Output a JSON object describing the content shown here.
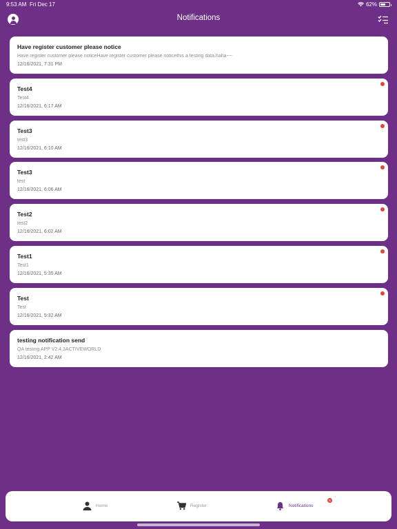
{
  "status_bar": {
    "time": "9:53 AM",
    "date": "Fri Dec 17",
    "battery": "62%",
    "battery_level": 0.62,
    "wifi_icon": "wifi-icon"
  },
  "header": {
    "title": "Notifications",
    "left_icon": "profile-icon",
    "right_icon": "mark-all-read-icon"
  },
  "notifications": [
    {
      "title": "Have register customer please notice",
      "body": "Have register customer please noticeHave register customer please noticethis a testing data.haha~~",
      "time": "12/16/2021, 7:31 PM",
      "unread": false
    },
    {
      "title": "Test4",
      "body": "Test4",
      "time": "12/16/2021, 6:17 AM",
      "unread": true
    },
    {
      "title": "Test3",
      "body": "test3",
      "time": "12/16/2021, 6:10 AM",
      "unread": true
    },
    {
      "title": "Test3",
      "body": "test",
      "time": "12/16/2021, 6:06 AM",
      "unread": true
    },
    {
      "title": "Test2",
      "body": "test2",
      "time": "12/16/2021, 6:02 AM",
      "unread": true
    },
    {
      "title": "Test1",
      "body": "Test1",
      "time": "12/16/2021, 5:35 AM",
      "unread": true
    },
    {
      "title": "Test",
      "body": "Test",
      "time": "12/16/2021, 5:32 AM",
      "unread": true
    },
    {
      "title": "testing notification send",
      "body": "QA testing APP V2.4.3ACTIVEWORLD",
      "time": "12/16/2021, 2:42 AM",
      "unread": false
    }
  ],
  "tabbar": {
    "tabs": [
      {
        "label": "Home",
        "icon": "person-icon",
        "active": false
      },
      {
        "label": "Register",
        "icon": "cart-icon",
        "active": false
      },
      {
        "label": "Notifications",
        "icon": "bell-icon",
        "active": true
      }
    ],
    "badge_count": "6"
  },
  "colors": {
    "background": "#6d3086",
    "unread_dot": "#e0463c",
    "active_tab": "#6d3086",
    "inactive_tab": "#999999"
  }
}
